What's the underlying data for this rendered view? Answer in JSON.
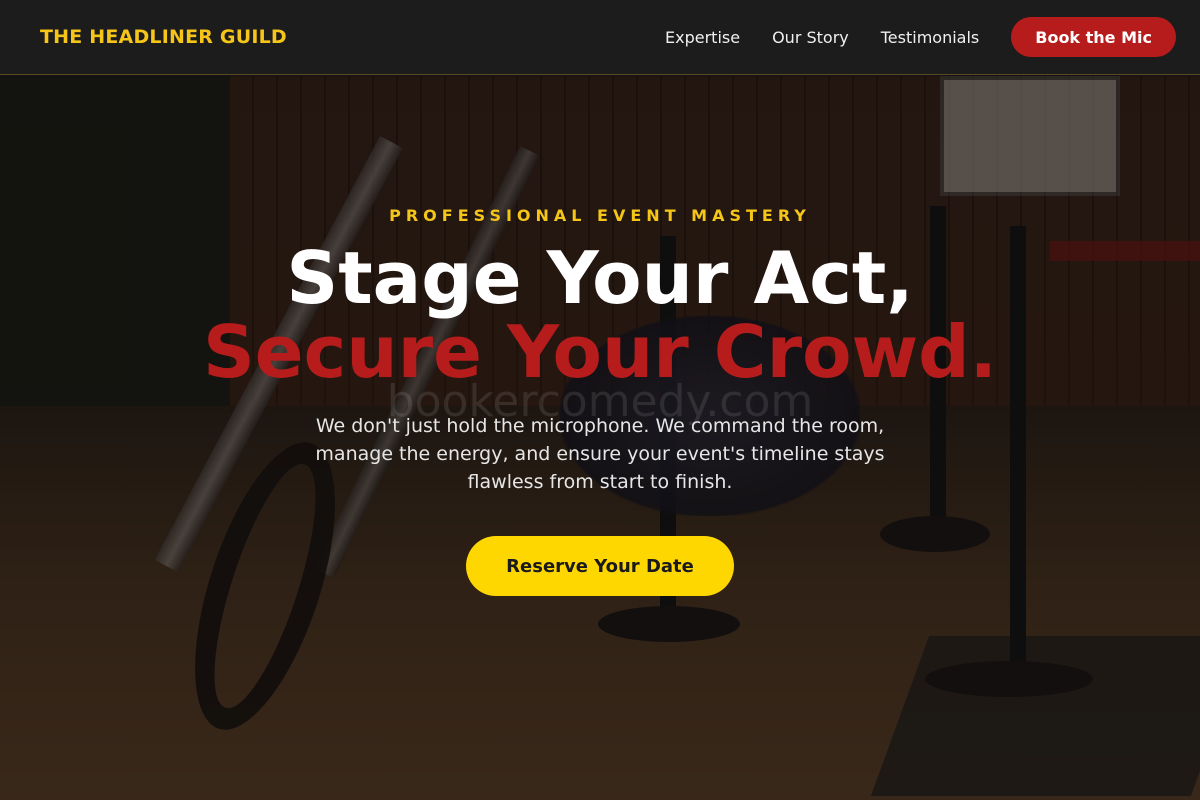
{
  "brand": {
    "name": "THE HEADLINER GUILD"
  },
  "nav": {
    "links": [
      {
        "label": "Expertise"
      },
      {
        "label": "Our Story"
      },
      {
        "label": "Testimonials"
      }
    ],
    "cta_label": "Book the Mic"
  },
  "hero": {
    "eyebrow": "PROFESSIONAL EVENT MASTERY",
    "headline_line1": "Stage Your Act,",
    "headline_line2": "Secure Your Crowd.",
    "watermark": "bookercomedy.com",
    "subtext": "We don't just hold the microphone. We command the room, manage the energy, and ensure your event's timeline stays flawless from start to finish.",
    "cta_label": "Reserve Your Date"
  },
  "colors": {
    "accent_yellow": "#f5c518",
    "accent_red": "#b71c1c",
    "cta_yellow": "#ffd700",
    "nav_bg": "#1c1c1c"
  }
}
